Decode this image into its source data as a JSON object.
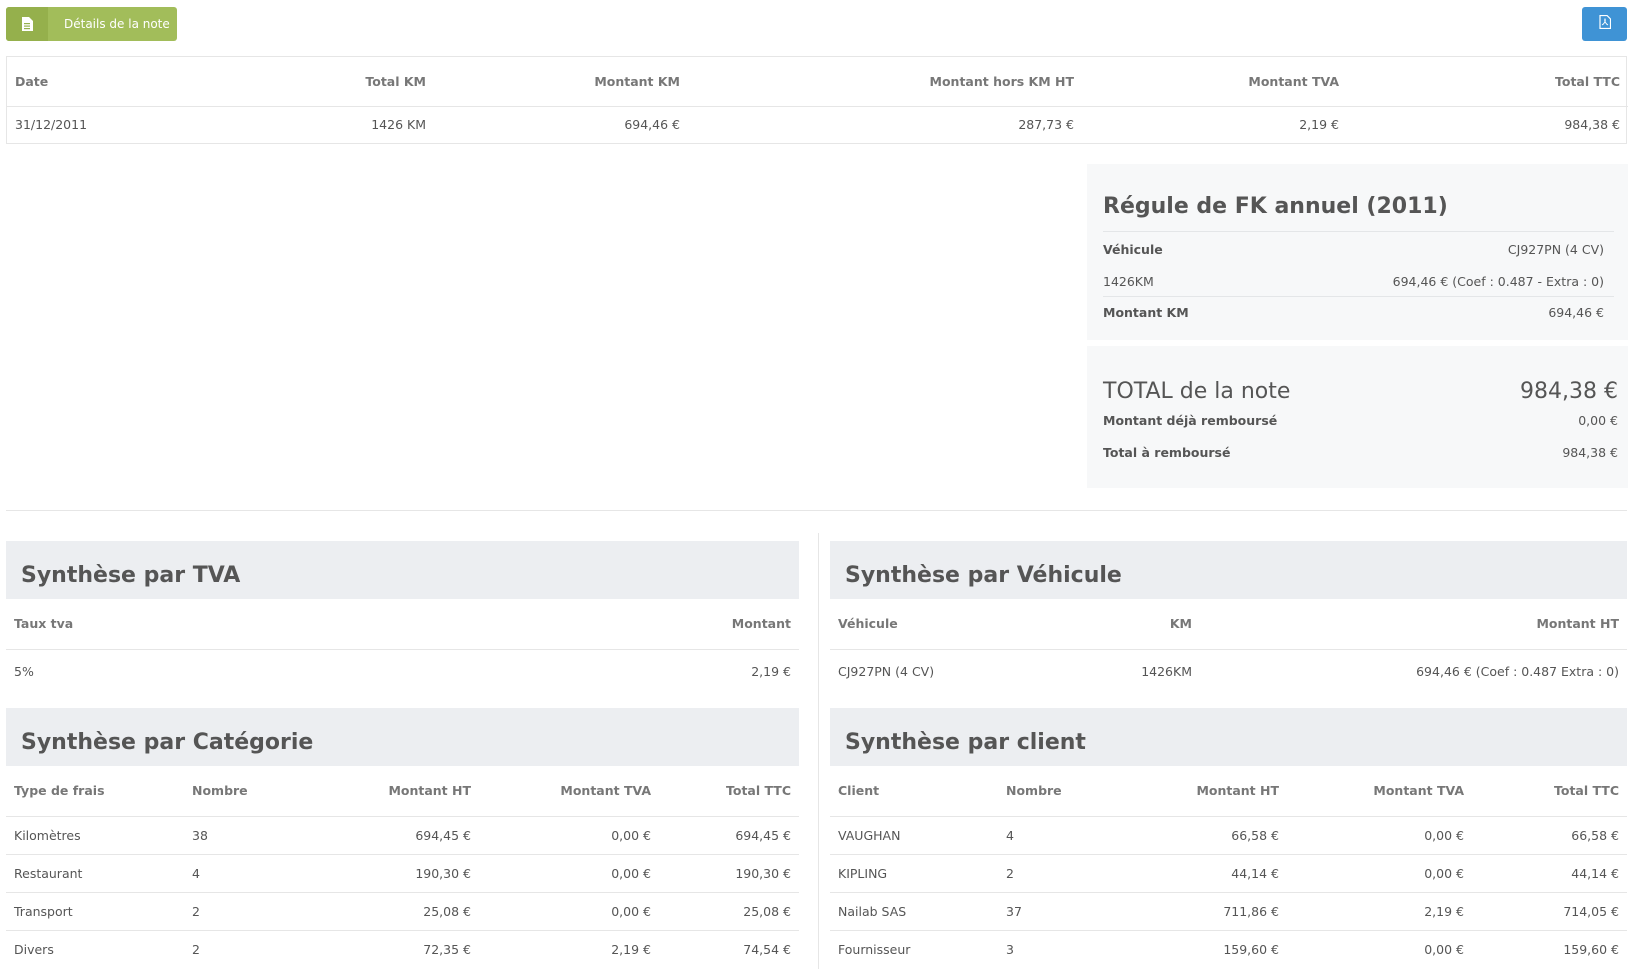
{
  "toolbar": {
    "details_label": "Détails de la note",
    "details_icon": "document-icon",
    "pdf_icon": "pdf-file-icon",
    "details_color": "#a2bd5a",
    "pdf_color": "#3f93d5"
  },
  "main_table": {
    "headers": [
      "Date",
      "Total KM",
      "Montant KM",
      "Montant hors KM HT",
      "Montant TVA",
      "Total TTC"
    ],
    "row": [
      "31/12/2011",
      "1426 KM",
      "694,46 €",
      "287,73 €",
      "2,19 €",
      "984,38 €"
    ]
  },
  "regule": {
    "title": "Régule de FK annuel (2011)",
    "vehicule_label": "Véhicule",
    "vehicule_value": "CJ927PN (4 CV)",
    "km_label": "1426KM",
    "km_value": "694,46 € (Coef : 0.487 - Extra : 0)",
    "montant_label": "Montant KM",
    "montant_value": "694,46 €"
  },
  "total": {
    "title": "TOTAL de la note",
    "value": "984,38 €",
    "deja_label": "Montant déjà remboursé",
    "deja_value": "0,00 €",
    "rembourse_label": "Total à remboursé",
    "rembourse_value": "984,38 €"
  },
  "synth_tva": {
    "title": "Synthèse par TVA",
    "headers": [
      "Taux tva",
      "Montant"
    ],
    "rows": [
      [
        "5%",
        "2,19 €"
      ]
    ]
  },
  "synth_vehicule": {
    "title": "Synthèse par Véhicule",
    "headers": [
      "Véhicule",
      "KM",
      "Montant HT"
    ],
    "rows": [
      [
        "CJ927PN (4 CV)",
        "1426KM",
        "694,46 € (Coef : 0.487 Extra : 0)"
      ]
    ]
  },
  "synth_categorie": {
    "title": "Synthèse par Catégorie",
    "headers": [
      "Type de frais",
      "Nombre",
      "Montant HT",
      "Montant TVA",
      "Total TTC"
    ],
    "rows": [
      [
        "Kilomètres",
        "38",
        "694,45 €",
        "0,00 €",
        "694,45 €"
      ],
      [
        "Restaurant",
        "4",
        "190,30 €",
        "0,00 €",
        "190,30 €"
      ],
      [
        "Transport",
        "2",
        "25,08 €",
        "0,00 €",
        "25,08 €"
      ],
      [
        "Divers",
        "2",
        "72,35 €",
        "2,19 €",
        "74,54 €"
      ]
    ]
  },
  "synth_client": {
    "title": "Synthèse par client",
    "headers": [
      "Client",
      "Nombre",
      "Montant HT",
      "Montant TVA",
      "Total TTC"
    ],
    "rows": [
      [
        "VAUGHAN",
        "4",
        "66,58 €",
        "0,00 €",
        "66,58 €"
      ],
      [
        "KIPLING",
        "2",
        "44,14 €",
        "0,00 €",
        "44,14 €"
      ],
      [
        "Nailab SAS",
        "37",
        "711,86 €",
        "2,19 €",
        "714,05 €"
      ],
      [
        "Fournisseur",
        "3",
        "159,60 €",
        "0,00 €",
        "159,60 €"
      ]
    ]
  }
}
